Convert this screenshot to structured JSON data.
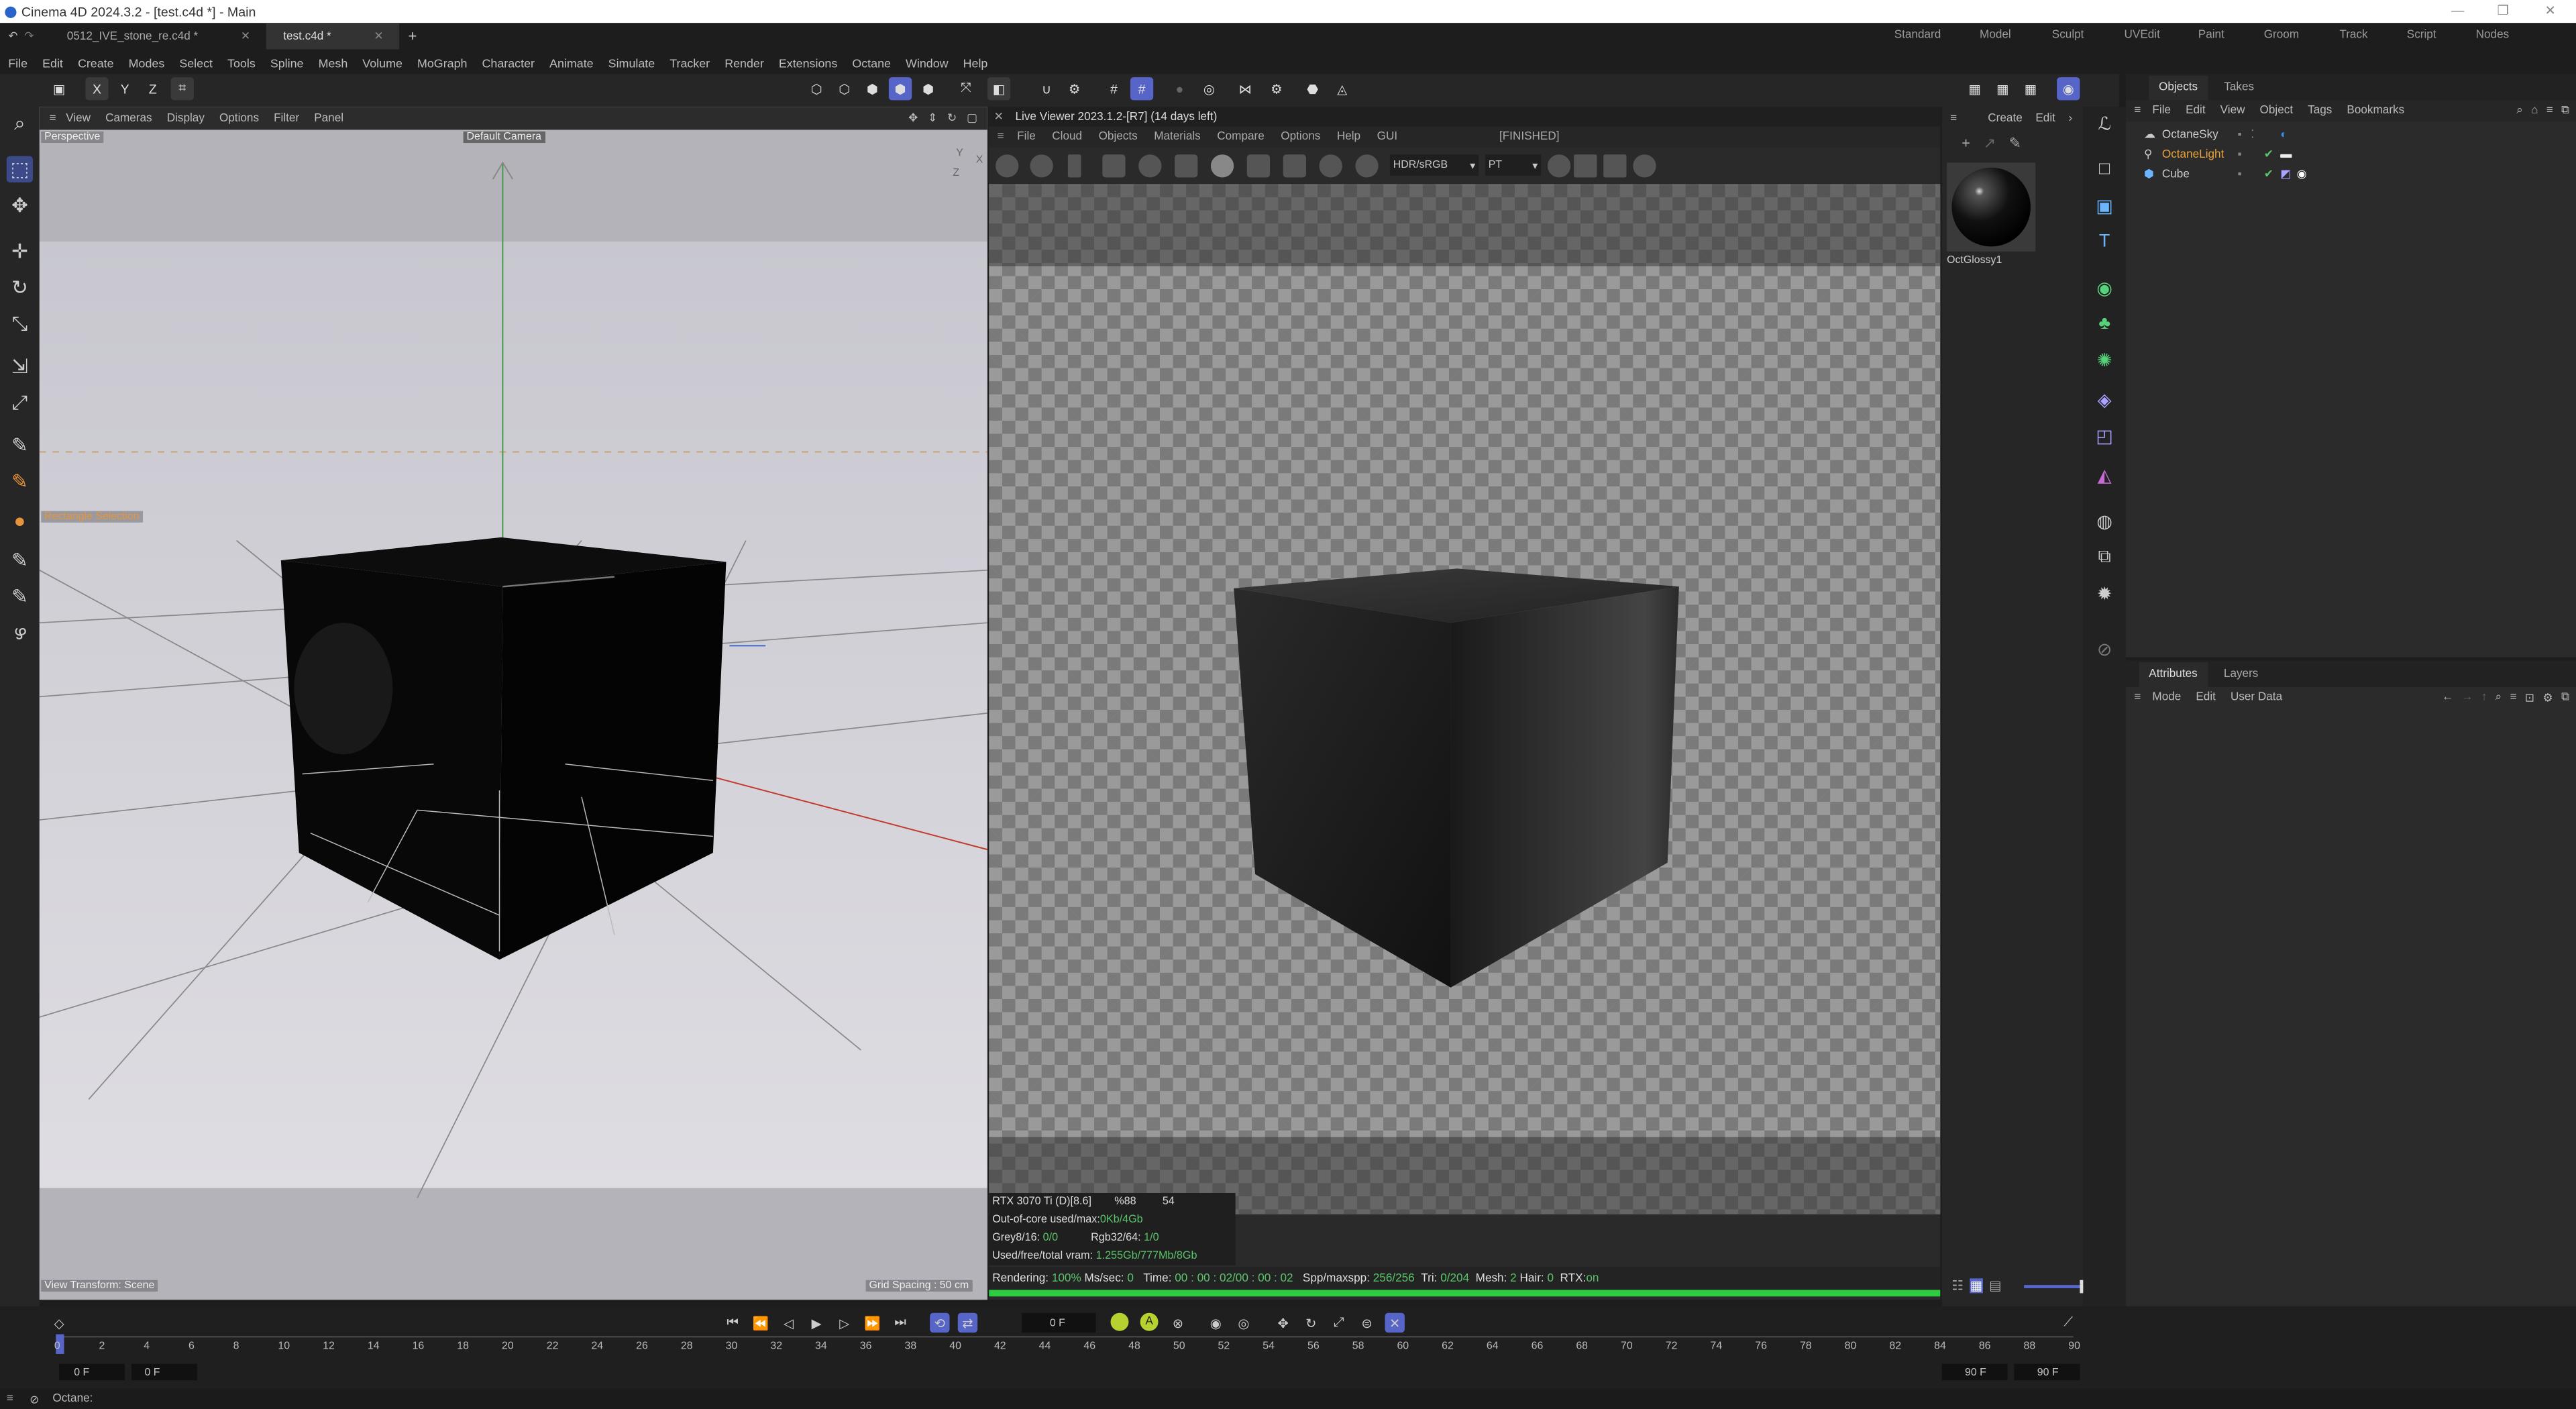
{
  "window": {
    "title": "Cinema 4D 2024.3.2 - [test.c4d *] - Main"
  },
  "tabs": [
    {
      "label": "0512_IVE_stone_re.c4d *"
    },
    {
      "label": "test.c4d *"
    }
  ],
  "layouts": [
    "Standard",
    "Model",
    "Sculpt",
    "UVEdit",
    "Paint",
    "Groom",
    "Track",
    "Script",
    "Nodes"
  ],
  "menu": [
    "File",
    "Edit",
    "Create",
    "Modes",
    "Select",
    "Tools",
    "Spline",
    "Mesh",
    "Volume",
    "MoGraph",
    "Character",
    "Animate",
    "Simulate",
    "Tracker",
    "Render",
    "Extensions",
    "Octane",
    "Window",
    "Help"
  ],
  "axis_toggles": [
    "X",
    "Y",
    "Z"
  ],
  "viewport": {
    "menu": [
      "View",
      "Cameras",
      "Display",
      "Options",
      "Filter",
      "Panel"
    ],
    "projection": "Perspective",
    "camera": "Default Camera",
    "hud_selection": "Rectangle Selection",
    "view_transform": "View Transform: Scene",
    "grid_spacing": "Grid Spacing : 50 cm"
  },
  "live_viewer": {
    "title": "Live Viewer 2023.1.2-[R7] (14 days left)",
    "menu": [
      "File",
      "Cloud",
      "Objects",
      "Materials",
      "Compare",
      "Options",
      "Help",
      "GUI"
    ],
    "state": "[FINISHED]",
    "color_space": "HDR/sRGB",
    "kernel": "PT",
    "stats": {
      "gpu": "RTX 3070 Ti (D)[8.6]",
      "gpu_pct": "%88",
      "gpu_temp": "54",
      "out_of_core_label": "Out-of-core used/max:",
      "out_of_core_value": "0Kb/4Gb",
      "grey_label": "Grey8/16:",
      "grey_value": "0/0",
      "rgb_label": "Rgb32/64:",
      "rgb_value": "1/0",
      "vram_label": "Used/free/total vram:",
      "vram_value": "1.255Gb/777Mb/8Gb"
    },
    "status": {
      "rendering_label": "Rendering:",
      "rendering_value": "100%",
      "ms_label": "Ms/sec:",
      "ms_value": "0",
      "time_label": "Time:",
      "time_value": "00 : 00 : 02/00 : 00 : 02",
      "spp_label": "Spp/maxspp:",
      "spp_value": "256/256",
      "tri_label": "Tri:",
      "tri_value": "0/204",
      "mesh_label": "Mesh:",
      "mesh_value": "2",
      "hair_label": "Hair:",
      "hair_value": "0",
      "rtx_label": "RTX:",
      "rtx_value": "on"
    },
    "progress": 1.0
  },
  "material_manager": {
    "menu": [
      "Create",
      "Edit"
    ],
    "materials": [
      {
        "name": "OctGlossy1"
      }
    ]
  },
  "objects_panel": {
    "tabs": [
      "Objects",
      "Takes"
    ],
    "menu": [
      "File",
      "Edit",
      "View",
      "Object",
      "Tags",
      "Bookmarks"
    ],
    "objects": [
      {
        "name": "OctaneSky",
        "color": "#c8c8c8"
      },
      {
        "name": "OctaneLight",
        "color": "#e8a33a"
      },
      {
        "name": "Cube",
        "color": "#c8c8c8"
      }
    ]
  },
  "attributes_panel": {
    "tabs": [
      "Attributes",
      "Layers"
    ],
    "menu": [
      "Mode",
      "Edit",
      "User Data"
    ]
  },
  "timeline": {
    "current_frame": "0 F",
    "start_a": "0 F",
    "start_b": "0 F",
    "end_a": "90 F",
    "end_b": "90 F",
    "ticks": [
      "0",
      "2",
      "4",
      "6",
      "8",
      "10",
      "12",
      "14",
      "16",
      "18",
      "20",
      "22",
      "24",
      "26",
      "28",
      "30",
      "32",
      "34",
      "36",
      "38",
      "40",
      "42",
      "44",
      "46",
      "48",
      "50",
      "52",
      "54",
      "56",
      "58",
      "60",
      "62",
      "64",
      "66",
      "68",
      "70",
      "72",
      "74",
      "76",
      "78",
      "80",
      "82",
      "84",
      "86",
      "88",
      "90"
    ]
  },
  "statusbar": {
    "text": "Octane:"
  },
  "colors": {
    "accent": "#5865c8",
    "progress": "#2ecc40",
    "highlight_text": "#5bc36a",
    "light_object": "#e8a33a"
  }
}
